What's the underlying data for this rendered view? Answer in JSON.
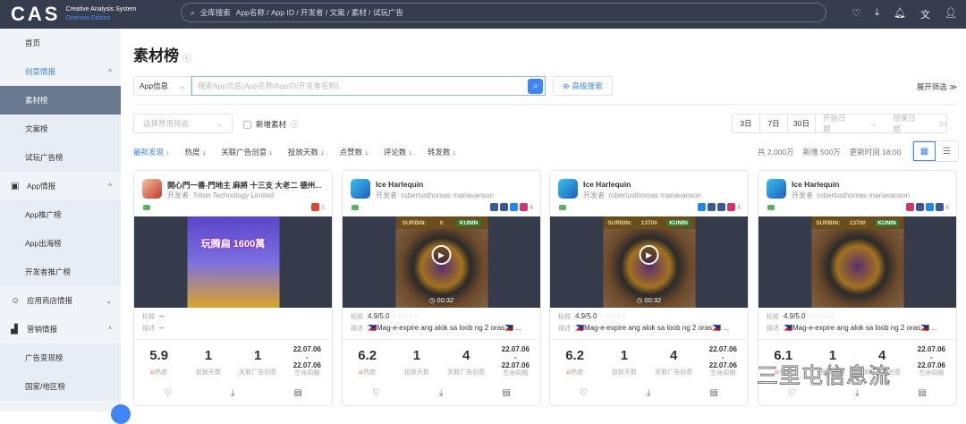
{
  "header": {
    "logo": "CAS",
    "logo_sub1": "Creative Analysis System",
    "logo_sub2": "Oversea Edition",
    "search_label": "全库搜索",
    "search_hint": "App名称 / App ID / 开发者 / 文案 / 素材 / 试玩广告",
    "icons": [
      "heart-icon",
      "download-icon",
      "bell-icon",
      "translate-icon",
      "user-icon"
    ]
  },
  "sidebar": {
    "items": [
      {
        "label": "首页",
        "type": "top"
      },
      {
        "label": "创意情报",
        "type": "group",
        "state": "open",
        "active": true
      },
      {
        "label": "素材榜",
        "type": "sub",
        "selected": true
      },
      {
        "label": "文案榜",
        "type": "sub"
      },
      {
        "label": "试玩广告榜",
        "type": "sub"
      },
      {
        "label": "App情报",
        "type": "group",
        "state": "open"
      },
      {
        "label": "App推广榜",
        "type": "sub"
      },
      {
        "label": "App出海榜",
        "type": "sub"
      },
      {
        "label": "开发者推广榜",
        "type": "sub"
      },
      {
        "label": "应用商店情报",
        "type": "group",
        "state": "closed"
      },
      {
        "label": "营销情报",
        "type": "group",
        "state": "open"
      },
      {
        "label": "广告变现榜",
        "type": "sub"
      },
      {
        "label": "国家/地区榜",
        "type": "sub"
      }
    ]
  },
  "page": {
    "title": "素材榜"
  },
  "search": {
    "select": "App信息",
    "placeholder": "搜索App信息(App名称/AppID/开发者名称)",
    "advanced": "高级搜索",
    "expand": "展开筛选 ≫"
  },
  "filters": {
    "common_placeholder": "选择常用筛选",
    "new_material": "新增素材",
    "ranges": [
      "3日",
      "7日",
      "30日"
    ],
    "start_date": "开始日期",
    "end_date": "结束日期"
  },
  "sorts": [
    "最新发现",
    "热度",
    "关联广告创意",
    "投放天数",
    "点赞数",
    "评论数",
    "转发数"
  ],
  "summary": {
    "total": "共 2,000万",
    "new": "新增 500万",
    "updated": "更新时间 18:00"
  },
  "labels": {
    "developer": "开发者",
    "title": "标题",
    "desc": "描述",
    "heat": "热度",
    "days": "投放天数",
    "related": "关联广告创意",
    "lifecycle": "生命周期",
    "dash": "-"
  },
  "cards": [
    {
      "app": "開心門一番-門地主 麻將 十三支 大老二 德州...",
      "developer": "Triton Technology Limited",
      "platform_count": "1",
      "title": "--",
      "desc": "--",
      "heat": "5.9",
      "days": "1",
      "related": "1",
      "start": "22.07.06",
      "end": "22.07.06",
      "video": false,
      "thumb_text": "玩腾扁 1600萬"
    },
    {
      "app": "Ice Harlequin",
      "developer": "robertusthomas mariavanson",
      "platform_count": "4",
      "title": "4.9/5.0",
      "desc": "🇵🇭Mag-e-expire ang alok sa loob ng 2 oras🇵🇭 ...",
      "heat": "6.2",
      "days": "1",
      "related": "4",
      "start": "22.07.06",
      "end": "22.07.06",
      "video": true,
      "duration": "00:32",
      "score": "0"
    },
    {
      "app": "Ice Harlequin",
      "developer": "robertusthomas mariavanson",
      "platform_count": "4",
      "title": "4.9/5.0",
      "desc": "🇵🇭Mag-e-expire ang alok sa loob ng 2 oras🇵🇭 ...",
      "heat": "6.2",
      "days": "1",
      "related": "4",
      "start": "22.07.06",
      "end": "22.07.06",
      "video": true,
      "duration": "00:32",
      "score": "13700"
    },
    {
      "app": "Ice Harlequin",
      "developer": "robertusthomas mariavanson",
      "platform_count": "4",
      "title": "4.9/5.0",
      "desc": "🇵🇭Mag-e-expire ang alok sa loob ng 2 oras🇵🇭 ...",
      "heat": "6.1",
      "days": "1",
      "related": "4",
      "start": "22.07.06",
      "end": "22.07.06",
      "video": false,
      "score": "13700"
    }
  ],
  "game": {
    "surbin": "SURBIN:",
    "kunin": "KUNIN"
  },
  "watermark": "三里屯信息流"
}
